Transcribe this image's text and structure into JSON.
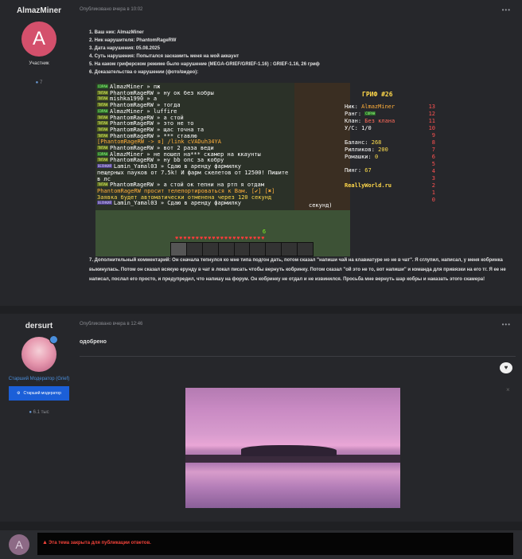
{
  "post1": {
    "author": "AlmazMiner",
    "avatar_letter": "A",
    "role": "Участник",
    "post_count": "7",
    "timestamp": "Опубликовано вчера в 10:02",
    "menu": "•••",
    "lines": [
      "1. Ваш ник: AlmazMiner",
      "2. Ник нарушителя: PhantomRageRW",
      "3. Дата нарушения: 05.08.2025",
      "4. Суть нарушения: Попытался заскамить меня на мой аккаунт",
      "5. На каком гриферском режиме было нарушение (MEGA-GRIEF/GRIEF-1.16) : GRIEF-1.16, 26 гриф",
      "6. Доказательства о нарушении (фото/видео):"
    ],
    "comment": "7. Дополнительный комментарий: Он сначала тепнулся ко мне типа подгон дать, потом сказал \"напиши чай на клавиатуре но не в чат\". Я сглупил, написал, у меня кобринка выкинулась. Потом он сказал всякую ерунду в чат в локал писать чтобы вернуть кобринку. Потом сказал \"ой это не то, вот напиши\" и команда для привязки на его тг. Я ее не написал, послал его просто, и предупредил, что напишу на форум. Он кобринку не отдал и не извинился. Просьба мне вернуть шар кобры и наказать этого скамера!"
  },
  "screenshot": {
    "chat": [
      {
        "tag": "СОРАН",
        "tagtype": "c",
        "name": "AlmazMiner",
        "msg": " » пж"
      },
      {
        "tag": "ТИТАН",
        "tagtype": "t",
        "name": "PhantomRageRW",
        "msg": " » ну ок без кобры"
      },
      {
        "tag": "ТИТАН",
        "tagtype": "t",
        "name": "",
        "msg": "mishka1990 » а"
      },
      {
        "tag": "ТИТАН",
        "tagtype": "t",
        "name": "PhantomRageRW",
        "msg": " » тогда"
      },
      {
        "tag": "СОРАН",
        "tagtype": "c",
        "name": "AlmazMiner",
        "msg": " » luffire"
      },
      {
        "tag": "ТИТАН",
        "tagtype": "t",
        "name": "PhantomRageRW",
        "msg": " » а стой"
      },
      {
        "tag": "ТИТАН",
        "tagtype": "t",
        "name": "PhantomRageRW",
        "msg": " » это не то"
      },
      {
        "tag": "ТИТАН",
        "tagtype": "t",
        "name": "PhantomRageRW",
        "msg": " » щас точна та"
      },
      {
        "tag": "ТИТАН",
        "tagtype": "t",
        "name": "PhantomRageRW",
        "msg": " » *** ставлю"
      },
      {
        "tag": "",
        "tagtype": "",
        "name": "",
        "msg": "[PhantomRageRW -> я] /link cVADuh34YA"
      },
      {
        "tag": "ТИТАН",
        "tagtype": "t",
        "name": "PhantomRageRW",
        "msg": " » вот 2 раза веди"
      },
      {
        "tag": "СОРАН",
        "tagtype": "c",
        "name": "AlmazMiner",
        "msg": " » не пошел на*** скамер на ккаунты"
      },
      {
        "tag": "ТИТАН",
        "tagtype": "t",
        "name": "PhantomRageRW",
        "msg": " » ну bb опс за кобру"
      },
      {
        "tag": "ВЕЛИКИЙ",
        "tagtype": "v",
        "name": "Lamin_Yamal03",
        "msg": " » Сдаю в аренду фармилку"
      },
      {
        "tag": "",
        "tagtype": "",
        "name": "",
        "msg": " пещерных пауков от 7.5k! И фарм скелетов от 12500! Пишите"
      },
      {
        "tag": "",
        "tagtype": "",
        "name": "",
        "msg": "в лс"
      },
      {
        "tag": "ТИТАН",
        "tagtype": "t",
        "name": "PhantomRageRW",
        "msg": " » а стой ок тепни на ртп я отдам"
      },
      {
        "tag": "",
        "tagtype": "",
        "name": "",
        "msg": "PhantomRageRW просит телепортироваться к Вам. [✔] [✖]"
      },
      {
        "tag": "",
        "tagtype": "",
        "name": "",
        "msg": "Заявка будет автоматически отменена через 120 секунд"
      },
      {
        "tag": "ВЕЛИКИЙ",
        "tagtype": "v",
        "name": "Lamin_Yamal03",
        "msg": " » Сдаю в аренду фармилку"
      }
    ],
    "scoreboard": {
      "title": "ГРИФ #26",
      "nick_label": "Ник:",
      "nick": "AlmazMiner",
      "rank_label": "Ранг:",
      "rank": "СОРАН",
      "clan_label": "Клан:",
      "clan": "Без клана",
      "kd_label": "У/С:",
      "kd": "1/0",
      "balance_label": "Баланс:",
      "balance": "268",
      "rillik_label": "Рилликов:",
      "rillik": "200",
      "romashki_label": "Ромашки:",
      "romashki": "0",
      "ping_label": "Пинг:",
      "ping": "67",
      "server": "ReallyWorld.ru",
      "numbers": [
        "13",
        "12",
        "11",
        "10",
        "9",
        "8",
        "7",
        "6",
        "5",
        "4",
        "3",
        "2",
        "1",
        "0"
      ]
    },
    "hotbar_level": "6",
    "side_text": "секунд)"
  },
  "post2": {
    "author": "dersurt",
    "role": "Старший Модератор (Grief)",
    "badge": "Старший модератор",
    "post_count": "6.1 тыс",
    "timestamp": "Опубликовано вчера в 12:46",
    "menu": "•••",
    "text": "одобрено",
    "close_mark": "×"
  },
  "closed_notice": {
    "avatar_letter": "A",
    "text": "Эта тема закрыта для публикации ответов."
  }
}
